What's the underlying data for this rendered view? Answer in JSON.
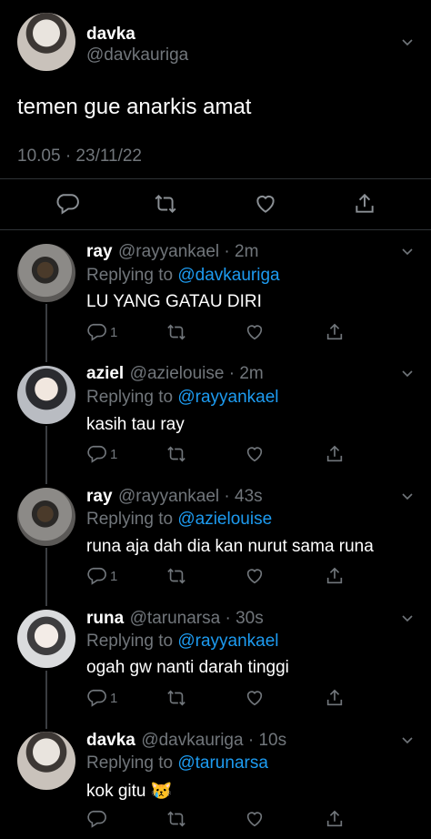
{
  "main_tweet": {
    "display_name": "davka",
    "handle": "@davkauriga",
    "text": "temen gue anarkis amat",
    "timestamp": "10.05 · 23/11/22"
  },
  "replies": [
    {
      "display_name": "ray",
      "handle_time": "@rayyankael · 2m",
      "replying_label": "Replying to",
      "replying_to": "@davkauriga",
      "text": "LU YANG GATAU DIRI",
      "reply_count": "1"
    },
    {
      "display_name": "aziel",
      "handle_time": "@azielouise · 2m",
      "replying_label": "Replying to",
      "replying_to": "@rayyankael",
      "text": "kasih tau ray",
      "reply_count": "1"
    },
    {
      "display_name": "ray",
      "handle_time": "@rayyankael · 43s",
      "replying_label": "Replying to",
      "replying_to": "@azielouise",
      "text": "runa aja dah dia kan nurut sama runa",
      "reply_count": "1"
    },
    {
      "display_name": "runa",
      "handle_time": "@tarunarsa · 30s",
      "replying_label": "Replying to",
      "replying_to": "@rayyankael",
      "text": "ogah gw nanti darah tinggi",
      "reply_count": "1"
    },
    {
      "display_name": "davka",
      "handle_time": "@davkauriga · 10s",
      "replying_label": "Replying to",
      "replying_to": "@tarunarsa",
      "text": "kok gitu 😿",
      "reply_count": ""
    }
  ],
  "colors": {
    "background": "#000000",
    "muted": "#71767b",
    "link": "#1d9bf0"
  },
  "icons": [
    "reply-icon",
    "retweet-icon",
    "like-icon",
    "share-icon",
    "chevron-down-icon"
  ]
}
